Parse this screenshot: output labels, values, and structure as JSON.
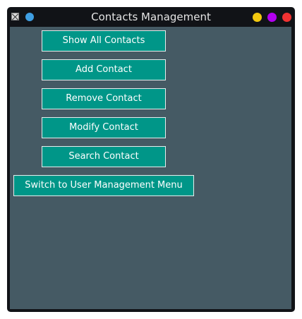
{
  "window": {
    "title": "Contacts Management"
  },
  "menu": {
    "show_all": "Show All Contacts",
    "add": "Add Contact",
    "remove": "Remove Contact",
    "modify": "Modify Contact",
    "search": "Search Contact",
    "switch_menu": "Switch to User Management Menu"
  },
  "colors": {
    "background": "#455a64",
    "button": "#009688",
    "titlebar": "#111317"
  }
}
